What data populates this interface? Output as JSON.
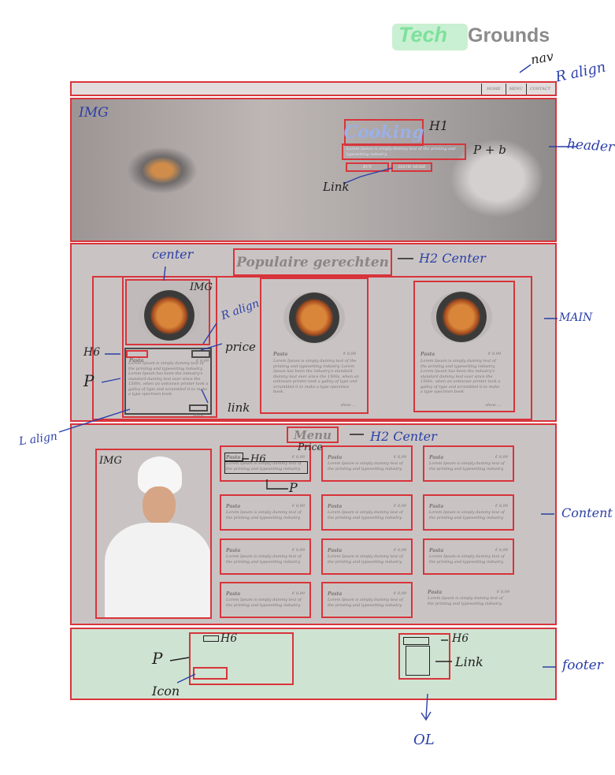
{
  "logo": {
    "tech": "Tech",
    "grounds": "Grounds",
    "accent_color": "#8fe3a8"
  },
  "nav": {
    "links": [
      "HOME",
      "MENU",
      "CONTACT"
    ]
  },
  "header": {
    "title": "Cooking",
    "tagline": "Lorem Ipsum is simply dummy text of the printing and typesetting industry.",
    "button1": "BUY",
    "button2": "SHOW MORE"
  },
  "main": {
    "heading": "Populaire gerechten",
    "cards": [
      {
        "title": "Pasta",
        "price": "€ 8,99",
        "text": "Lorem Ipsum is simply dummy text of the printing and typesetting industry. Lorem Ipsum has been the industry's standard dummy text ever since the 1500s, when an unknown printer took a galley of type and scrambled it to make a type specimen book.",
        "link": "show"
      },
      {
        "title": "Pasta",
        "price": "€ 8,99",
        "text": "Lorem Ipsum is simply dummy text of the printing and typesetting industry. Lorem Ipsum has been the industry's standard dummy text ever since the 1500s, when an unknown printer took a galley of type and scrambled it to make a type specimen book.",
        "link": "show ..."
      },
      {
        "title": "Pasta",
        "price": "€ 8,99",
        "text": "Lorem Ipsum is simply dummy text of the printing and typesetting industry. Lorem Ipsum has been the industry's standard dummy text ever since the 1500s, when an unknown printer took a galley of type and scrambled it to make a type specimen book.",
        "link": "show ..."
      }
    ]
  },
  "content": {
    "heading": "Menu",
    "items": [
      {
        "title": "Pasta",
        "price": "€ 8,99",
        "text": "Lorem Ipsum is simply dummy text of the printing and typesetting industry."
      },
      {
        "title": "Pasta",
        "price": "€ 8,99",
        "text": "Lorem Ipsum is simply dummy text of the printing and typesetting industry."
      },
      {
        "title": "Pasta",
        "price": "€ 8,99",
        "text": "Lorem Ipsum is simply dummy text of the printing and typesetting industry."
      },
      {
        "title": "Pasta",
        "price": "€ 8,99",
        "text": "Lorem Ipsum is simply dummy text of the printing and typesetting industry."
      },
      {
        "title": "Pasta",
        "price": "€ 8,99",
        "text": "Lorem Ipsum is simply dummy text of the printing and typesetting industry."
      },
      {
        "title": "Pasta",
        "price": "€ 8,99",
        "text": "Lorem Ipsum is simply dummy text of the printing and typesetting industry."
      },
      {
        "title": "Pasta",
        "price": "€ 8,99",
        "text": "Lorem Ipsum is simply dummy text of the printing and typesetting industry."
      },
      {
        "title": "Pasta",
        "price": "€ 8,99",
        "text": "Lorem Ipsum is simply dummy text of the printing and typesetting industry."
      },
      {
        "title": "Pasta",
        "price": "€ 8,99",
        "text": "Lorem Ipsum is simply dummy text of the printing and typesetting industry."
      },
      {
        "title": "Pasta",
        "price": "€ 8,99",
        "text": "Lorem Ipsum is simply dummy text of the printing and typesetting industry."
      },
      {
        "title": "Pasta",
        "price": "€ 8,99",
        "text": "Lorem Ipsum is simply dummy text of the printing and typesetting industry."
      },
      {
        "title": "Pasta",
        "price": "€ 8,99",
        "text": "Lorem Ipsum is simply dummy text of the printing and typesetting industry."
      }
    ]
  },
  "annotations": {
    "nav": "nav",
    "r_align": "R align",
    "img": "IMG",
    "h1": "H1",
    "p_plus_b": "P + b",
    "header": "header",
    "link": "Link",
    "center": "center",
    "h2_center_main": "H2 Center",
    "img_card": "IMG",
    "r_align_card": "R align",
    "price": "price",
    "main": "MAIN",
    "h6": "H6",
    "p": "P",
    "link_card": "link",
    "l_align": "L align",
    "h2_center_menu": "H2 Center",
    "price_menu": "Price",
    "h6_menu": "H6",
    "p_menu": "P",
    "img_chef": "IMG",
    "content": "Content",
    "h6_footer": "H6",
    "p_footer": "P",
    "icon": "Icon",
    "h6_footer2": "H6",
    "link_footer": "Link",
    "footer": "footer",
    "ol": "OL"
  }
}
